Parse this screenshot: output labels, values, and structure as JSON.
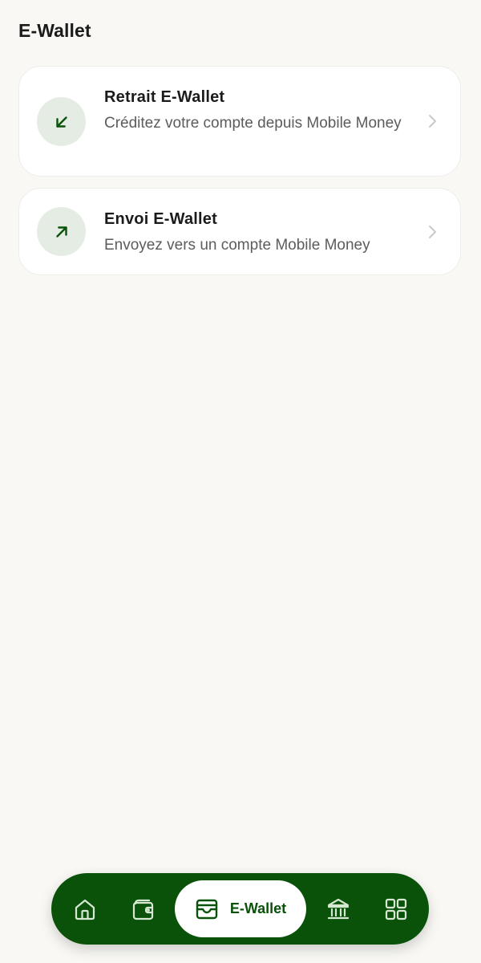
{
  "header": {
    "title": "E-Wallet"
  },
  "cards": [
    {
      "title": "Retrait E-Wallet",
      "description": "Créditez votre compte depuis Mobile Money",
      "icon": "arrow-down-left-icon"
    },
    {
      "title": "Envoi E-Wallet",
      "description": "Envoyez vers un compte Mobile Money",
      "icon": "arrow-up-right-icon"
    }
  ],
  "bottom_nav": {
    "items": [
      {
        "icon": "home-icon",
        "active": false
      },
      {
        "icon": "wallet-icon",
        "active": false
      },
      {
        "icon": "e-wallet-icon",
        "label": "E-Wallet",
        "active": true
      },
      {
        "icon": "bank-icon",
        "active": false
      },
      {
        "icon": "grid-icon",
        "active": false
      }
    ]
  },
  "colors": {
    "background": "#f9f8f4",
    "brand_green": "#0a520a",
    "icon_circle": "#e5ece4",
    "card": "#ffffff",
    "nav_icon": "#d6e8d2"
  }
}
